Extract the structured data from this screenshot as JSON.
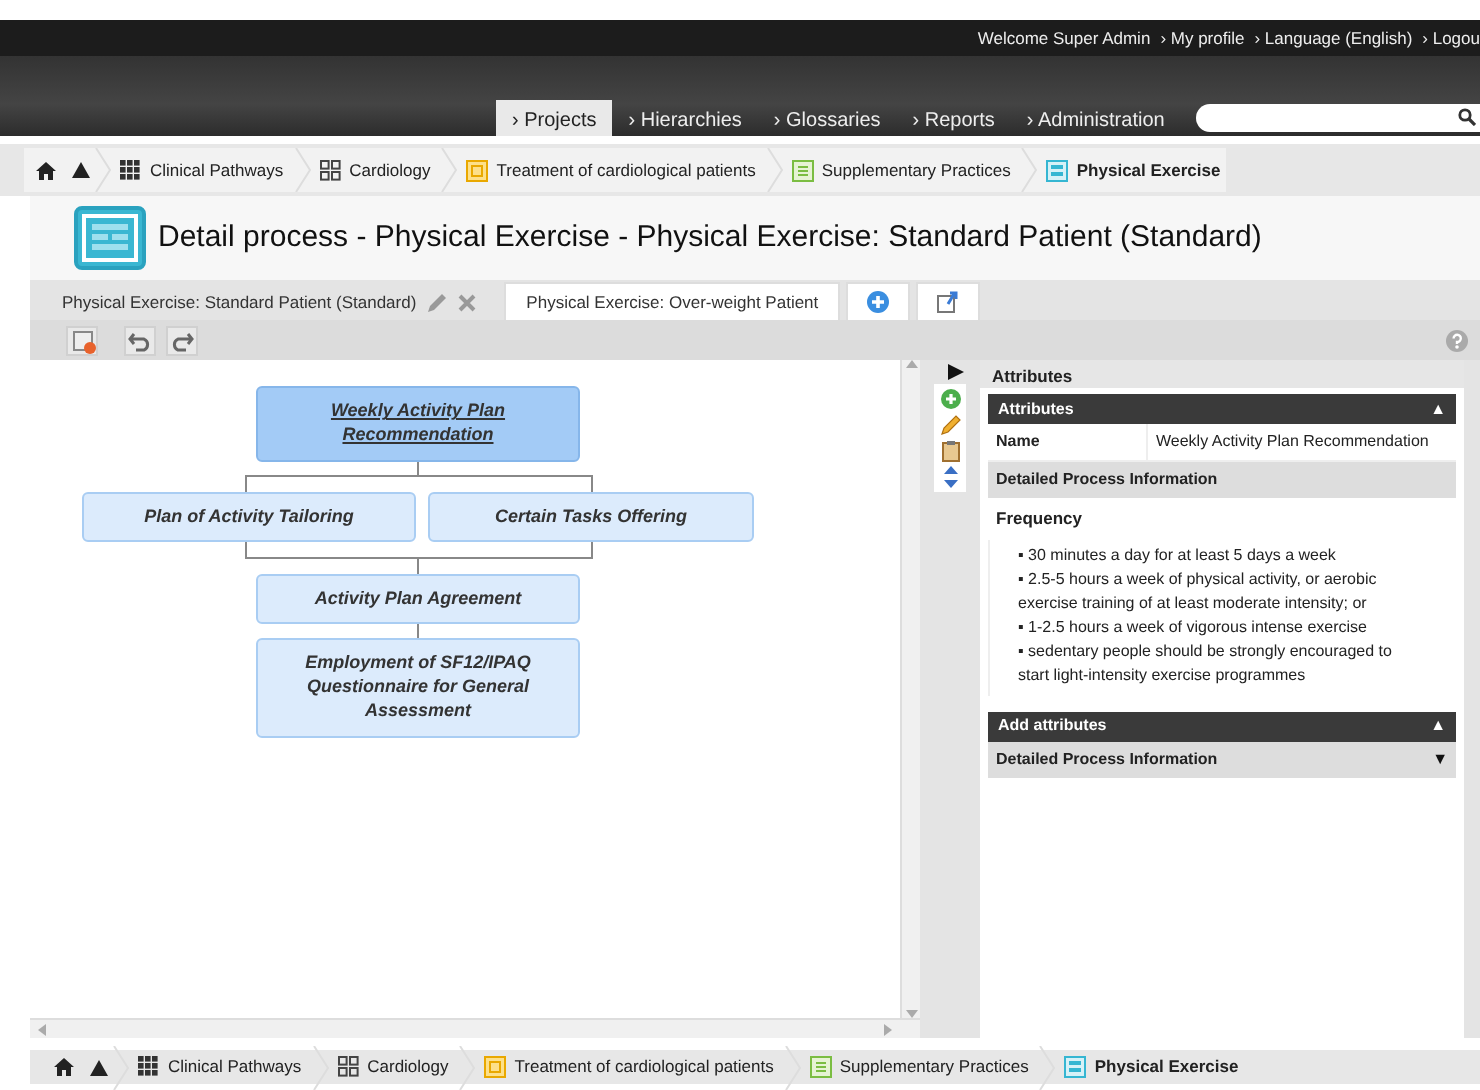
{
  "top_links": [
    "Welcome Super Admin",
    "› My profile",
    "› Language (English)",
    "› Logou"
  ],
  "nav": [
    {
      "label": "› Projects",
      "selected": true
    },
    {
      "label": "› Hierarchies",
      "selected": false
    },
    {
      "label": "› Glossaries",
      "selected": false
    },
    {
      "label": "› Reports",
      "selected": false
    },
    {
      "label": "› Administration",
      "selected": false
    }
  ],
  "breadcrumb": [
    {
      "label": "Clinical Pathways",
      "selected": false
    },
    {
      "label": "Cardiology",
      "selected": false
    },
    {
      "label": "Treatment of cardiological patients",
      "selected": false
    },
    {
      "label": "Supplementary Practices",
      "selected": false
    },
    {
      "label": "Physical Exercise",
      "selected": true
    }
  ],
  "title": "Detail process - Physical Exercise - Physical Exercise: Standard Patient (Standard)",
  "tabs": [
    {
      "label": "Physical Exercise: Standard Patient (Standard)",
      "selected": true
    },
    {
      "label": "Physical Exercise: Over-weight Patient",
      "selected": false
    }
  ],
  "diagram": {
    "nodes": [
      {
        "label": "Weekly Activity Plan Recommendation",
        "selected": true
      },
      {
        "label": "Plan of Activity Tailoring",
        "selected": false
      },
      {
        "label": "Certain Tasks Offering",
        "selected": false
      },
      {
        "label": "Activity Plan Agreement",
        "selected": false
      },
      {
        "label": "Employment of SF12/IPAQ Questionnaire for General Assessment",
        "selected": false
      }
    ]
  },
  "attributes_panel": {
    "heading": "Attributes",
    "section": {
      "title": "Attributes",
      "toggle": "▲"
    },
    "name_label": "Name",
    "name_value": "Weekly Activity Plan Recommendation",
    "group": "Detailed Process Information",
    "field": "Frequency",
    "bullets": [
      "▪ 30 minutes a day for at least 5 days a week",
      "▪ 2.5-5 hours a week of physical activity, or aerobic exercise training of at least moderate intensity; or",
      "▪ 1-2.5 hours a week of vigorous intense exercise",
      "▪ sedentary people should be strongly encouraged to start light-intensity exercise programmes"
    ],
    "add_section": {
      "title": "Add attributes",
      "toggle": "▲"
    },
    "add_group": {
      "title": "Detailed Process Information",
      "toggle": "▼"
    }
  },
  "bottom_breadcrumb": [
    {
      "label": "Clinical Pathways",
      "selected": false
    },
    {
      "label": "Cardiology",
      "selected": false
    },
    {
      "label": "Treatment of cardiological patients",
      "selected": false
    },
    {
      "label": "Supplementary Practices",
      "selected": false
    },
    {
      "label": "Physical Exercise",
      "selected": true
    }
  ]
}
